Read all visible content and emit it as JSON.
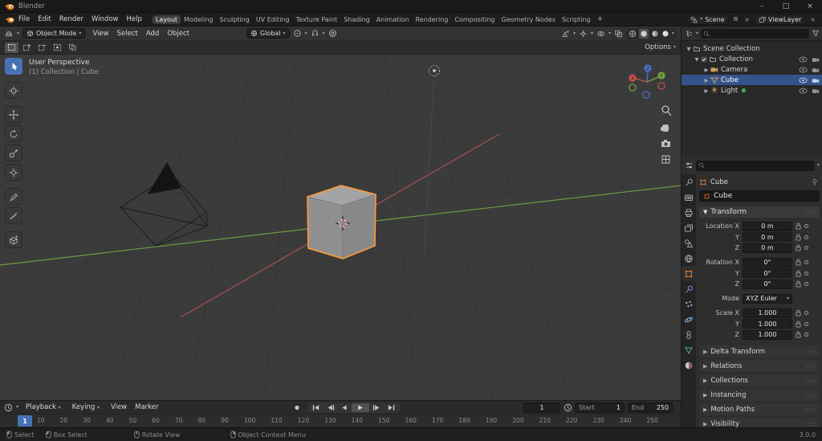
{
  "window": {
    "title": "Blender"
  },
  "menubar": {
    "menus": [
      "File",
      "Edit",
      "Render",
      "Window",
      "Help"
    ],
    "workspaces": [
      {
        "label": "Layout",
        "active": true
      },
      {
        "label": "Modeling"
      },
      {
        "label": "Sculpting"
      },
      {
        "label": "UV Editing"
      },
      {
        "label": "Texture Paint"
      },
      {
        "label": "Shading"
      },
      {
        "label": "Animation"
      },
      {
        "label": "Rendering"
      },
      {
        "label": "Compositing"
      },
      {
        "label": "Geometry Nodes"
      },
      {
        "label": "Scripting"
      }
    ],
    "workspace_add": "+",
    "scene": "Scene",
    "view_layer": "ViewLayer"
  },
  "viewport_header": {
    "mode": "Object Mode",
    "menus": [
      "View",
      "Select",
      "Add",
      "Object"
    ],
    "orientation": "Global",
    "options_label": "Options"
  },
  "viewport": {
    "perspective_label": "User Perspective",
    "context_label": "(1) Collection | Cube",
    "gizmo_x": "X",
    "gizmo_y": "Y",
    "gizmo_z": "Z"
  },
  "outliner": {
    "root_label": "Scene Collection",
    "collection_label": "Collection",
    "camera_label": "Camera",
    "cube_label": "Cube",
    "light_label": "Light"
  },
  "properties": {
    "breadcrumb": "Cube",
    "object_name": "Cube",
    "transform": {
      "title": "Transform",
      "rows": [
        {
          "label": "Location X",
          "value": "0 m"
        },
        {
          "label": "Y",
          "value": "0 m"
        },
        {
          "label": "Z",
          "value": "0 m"
        },
        {
          "label": "Rotation X",
          "value": "0°"
        },
        {
          "label": "Y",
          "value": "0°"
        },
        {
          "label": "Z",
          "value": "0°"
        }
      ],
      "mode_label": "Mode",
      "mode_value": "XYZ Euler",
      "scale_rows": [
        {
          "label": "Scale X",
          "value": "1.000"
        },
        {
          "label": "Y",
          "value": "1.000"
        },
        {
          "label": "Z",
          "value": "1.000"
        }
      ]
    },
    "panels": [
      "Delta Transform",
      "Relations",
      "Collections",
      "Instancing",
      "Motion Paths",
      "Visibility"
    ]
  },
  "timeline": {
    "playback_label": "Playback",
    "keying_label": "Keying",
    "menus": [
      "View",
      "Marker"
    ],
    "current_frame": "1",
    "start_label": "Start",
    "start_value": "1",
    "end_label": "End",
    "end_value": "250",
    "ticks": [
      "10",
      "20",
      "30",
      "40",
      "50",
      "60",
      "70",
      "80",
      "90",
      "100",
      "110",
      "120",
      "130",
      "140",
      "150",
      "160",
      "170",
      "180",
      "190",
      "200",
      "210",
      "220",
      "230",
      "240",
      "250"
    ]
  },
  "statusbar": {
    "items": [
      "Select",
      "Box Select",
      "Rotate View",
      "Object Context Menu"
    ],
    "version": "3.0.0"
  },
  "colors": {
    "accent": "#4772b3",
    "object_orange": "#e8833a",
    "selection_blue": "#35538b",
    "outline_orange": "#ff9b38",
    "axis_x": "#b25555",
    "axis_y": "#6c9a45"
  }
}
